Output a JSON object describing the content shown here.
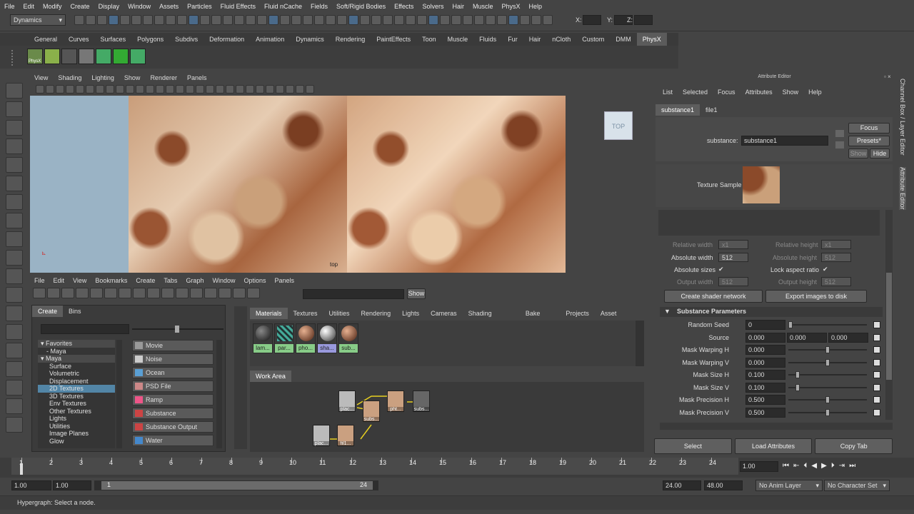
{
  "menubar": [
    "File",
    "Edit",
    "Modify",
    "Create",
    "Display",
    "Window",
    "Assets",
    "Particles",
    "Fluid Effects",
    "Fluid nCache",
    "Fields",
    "Soft/Rigid Bodies",
    "Effects",
    "Solvers",
    "Hair",
    "Muscle",
    "PhysX",
    "Help"
  ],
  "toolbar": {
    "mode": "Dynamics",
    "x_label": "X:",
    "y_label": "Y:",
    "z_label": "Z:"
  },
  "shelf_tabs": [
    "General",
    "Curves",
    "Surfaces",
    "Polygons",
    "Subdivs",
    "Deformation",
    "Animation",
    "Dynamics",
    "Rendering",
    "PaintEffects",
    "Toon",
    "Muscle",
    "Fluids",
    "Fur",
    "Hair",
    "nCloth",
    "Custom",
    "DMM",
    "PhysX"
  ],
  "shelf_active": "PhysX",
  "shelf_icon_label": "PhysX",
  "viewport": {
    "menu": [
      "View",
      "Shading",
      "Lighting",
      "Show",
      "Renderer",
      "Panels"
    ],
    "cube_label": "TOP",
    "cam_label": "top"
  },
  "hypershade": {
    "menu": [
      "File",
      "Edit",
      "View",
      "Bookmarks",
      "Create",
      "Tabs",
      "Graph",
      "Window",
      "Options",
      "Panels"
    ],
    "show_button": "Show",
    "left_tabs": [
      "Create",
      "Bins"
    ],
    "tree": [
      {
        "label": "Favorites",
        "type": "hdr"
      },
      {
        "label": "Maya",
        "type": "sub"
      },
      {
        "label": "Maya",
        "type": "hdr"
      },
      {
        "label": "Surface",
        "type": "item"
      },
      {
        "label": "Volumetric",
        "type": "item"
      },
      {
        "label": "Displacement",
        "type": "item"
      },
      {
        "label": "2D Textures",
        "type": "sel"
      },
      {
        "label": "3D Textures",
        "type": "item"
      },
      {
        "label": "Env Textures",
        "type": "item"
      },
      {
        "label": "Other Textures",
        "type": "item"
      },
      {
        "label": "Lights",
        "type": "item"
      },
      {
        "label": "Utilities",
        "type": "item"
      },
      {
        "label": "Image Planes",
        "type": "item"
      },
      {
        "label": "Glow",
        "type": "item"
      }
    ],
    "create_nodes": [
      "Movie",
      "Noise",
      "Ocean",
      "PSD File",
      "Ramp",
      "Substance",
      "Substance Output",
      "Water"
    ],
    "right_tabs": [
      "Materials",
      "Textures",
      "Utilities",
      "Rendering",
      "Lights",
      "Cameras",
      "Shading Groups",
      "Bake Sets",
      "Projects",
      "Asset N"
    ],
    "swatches": [
      "lam...",
      "par...",
      "pho...",
      "sha...",
      "sub..."
    ],
    "work_area_tab": "Work Area",
    "work_nodes": [
      "plac...",
      "subs...",
      "pht...",
      "subs...",
      "plac...",
      "fil1..."
    ]
  },
  "attribute_editor": {
    "title": "Attribute Editor",
    "menu": [
      "List",
      "Selected",
      "Focus",
      "Attributes",
      "Show",
      "Help"
    ],
    "tabs": [
      "substance1",
      "file1"
    ],
    "node_label": "substance:",
    "node_value": "substance1",
    "focus_button": "Focus",
    "presets_button": "Presets*",
    "show_button": "Show",
    "hide_button": "Hide",
    "texture_sample_label": "Texture Sample",
    "relative_width": "Relative width",
    "relative_width_value": "x1",
    "relative_height": "Relative height",
    "relative_height_value": "x1",
    "absolute_width": "Absolute width",
    "absolute_width_value": "512",
    "absolute_height": "Absolute height",
    "absolute_height_value": "512",
    "absolute_sizes": "Absolute sizes",
    "lock_aspect": "Lock aspect ratio",
    "output_width": "Output width",
    "output_width_value": "512",
    "output_height": "Output height",
    "output_height_value": "512",
    "create_shader_btn": "Create shader network",
    "export_images_btn": "Export images to disk",
    "section": "Substance Parameters",
    "params": [
      {
        "label": "Random Seed",
        "value": "0",
        "pos": 0.0
      },
      {
        "label": "Source",
        "values": [
          "0.000",
          "0.000",
          "0.000"
        ]
      },
      {
        "label": "Mask Warping H",
        "value": "0.000",
        "pos": 0.5
      },
      {
        "label": "Mask Warping V",
        "value": "0.000",
        "pos": 0.5
      },
      {
        "label": "Mask Size H",
        "value": "0.100",
        "pos": 0.1
      },
      {
        "label": "Mask Size V",
        "value": "0.100",
        "pos": 0.1
      },
      {
        "label": "Mask Precision H",
        "value": "0.500",
        "pos": 0.5
      },
      {
        "label": "Mask Precision V",
        "value": "0.500",
        "pos": 0.5
      }
    ],
    "bottom_buttons": [
      "Select",
      "Load Attributes",
      "Copy Tab"
    ],
    "side_tabs": [
      "Channel Box / Layer Editor",
      "Attribute Editor"
    ]
  },
  "timeline": {
    "ticks": [
      "1",
      "2",
      "3",
      "4",
      "5",
      "6",
      "7",
      "8",
      "9",
      "10",
      "11",
      "12",
      "13",
      "14",
      "15",
      "16",
      "17",
      "18",
      "19",
      "20",
      "21",
      "22",
      "23",
      "24"
    ],
    "current_frame": "1.00"
  },
  "range": {
    "start": "1.00",
    "start2": "1.00",
    "range_start": "1",
    "range_end": "24",
    "end": "24.00",
    "end2": "48.00",
    "anim_layer": "No Anim Layer",
    "char_set": "No Character Set"
  },
  "help_line": "Hypergraph: Select a node."
}
